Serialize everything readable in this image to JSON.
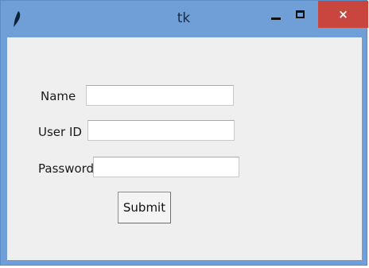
{
  "window": {
    "title": "tk",
    "icon": "tk-feather-icon",
    "controls": {
      "minimize": "minimize-icon",
      "maximize": "maximize-icon",
      "close": "close-icon",
      "close_glyph": "×"
    },
    "colors": {
      "titlebar": "#6f9fd6",
      "close": "#c8463d",
      "client": "#efefef"
    }
  },
  "form": {
    "name": {
      "label": "Name",
      "value": ""
    },
    "user_id": {
      "label": "User ID",
      "value": ""
    },
    "password": {
      "label": "Password",
      "value": ""
    },
    "submit_label": "Submit"
  }
}
